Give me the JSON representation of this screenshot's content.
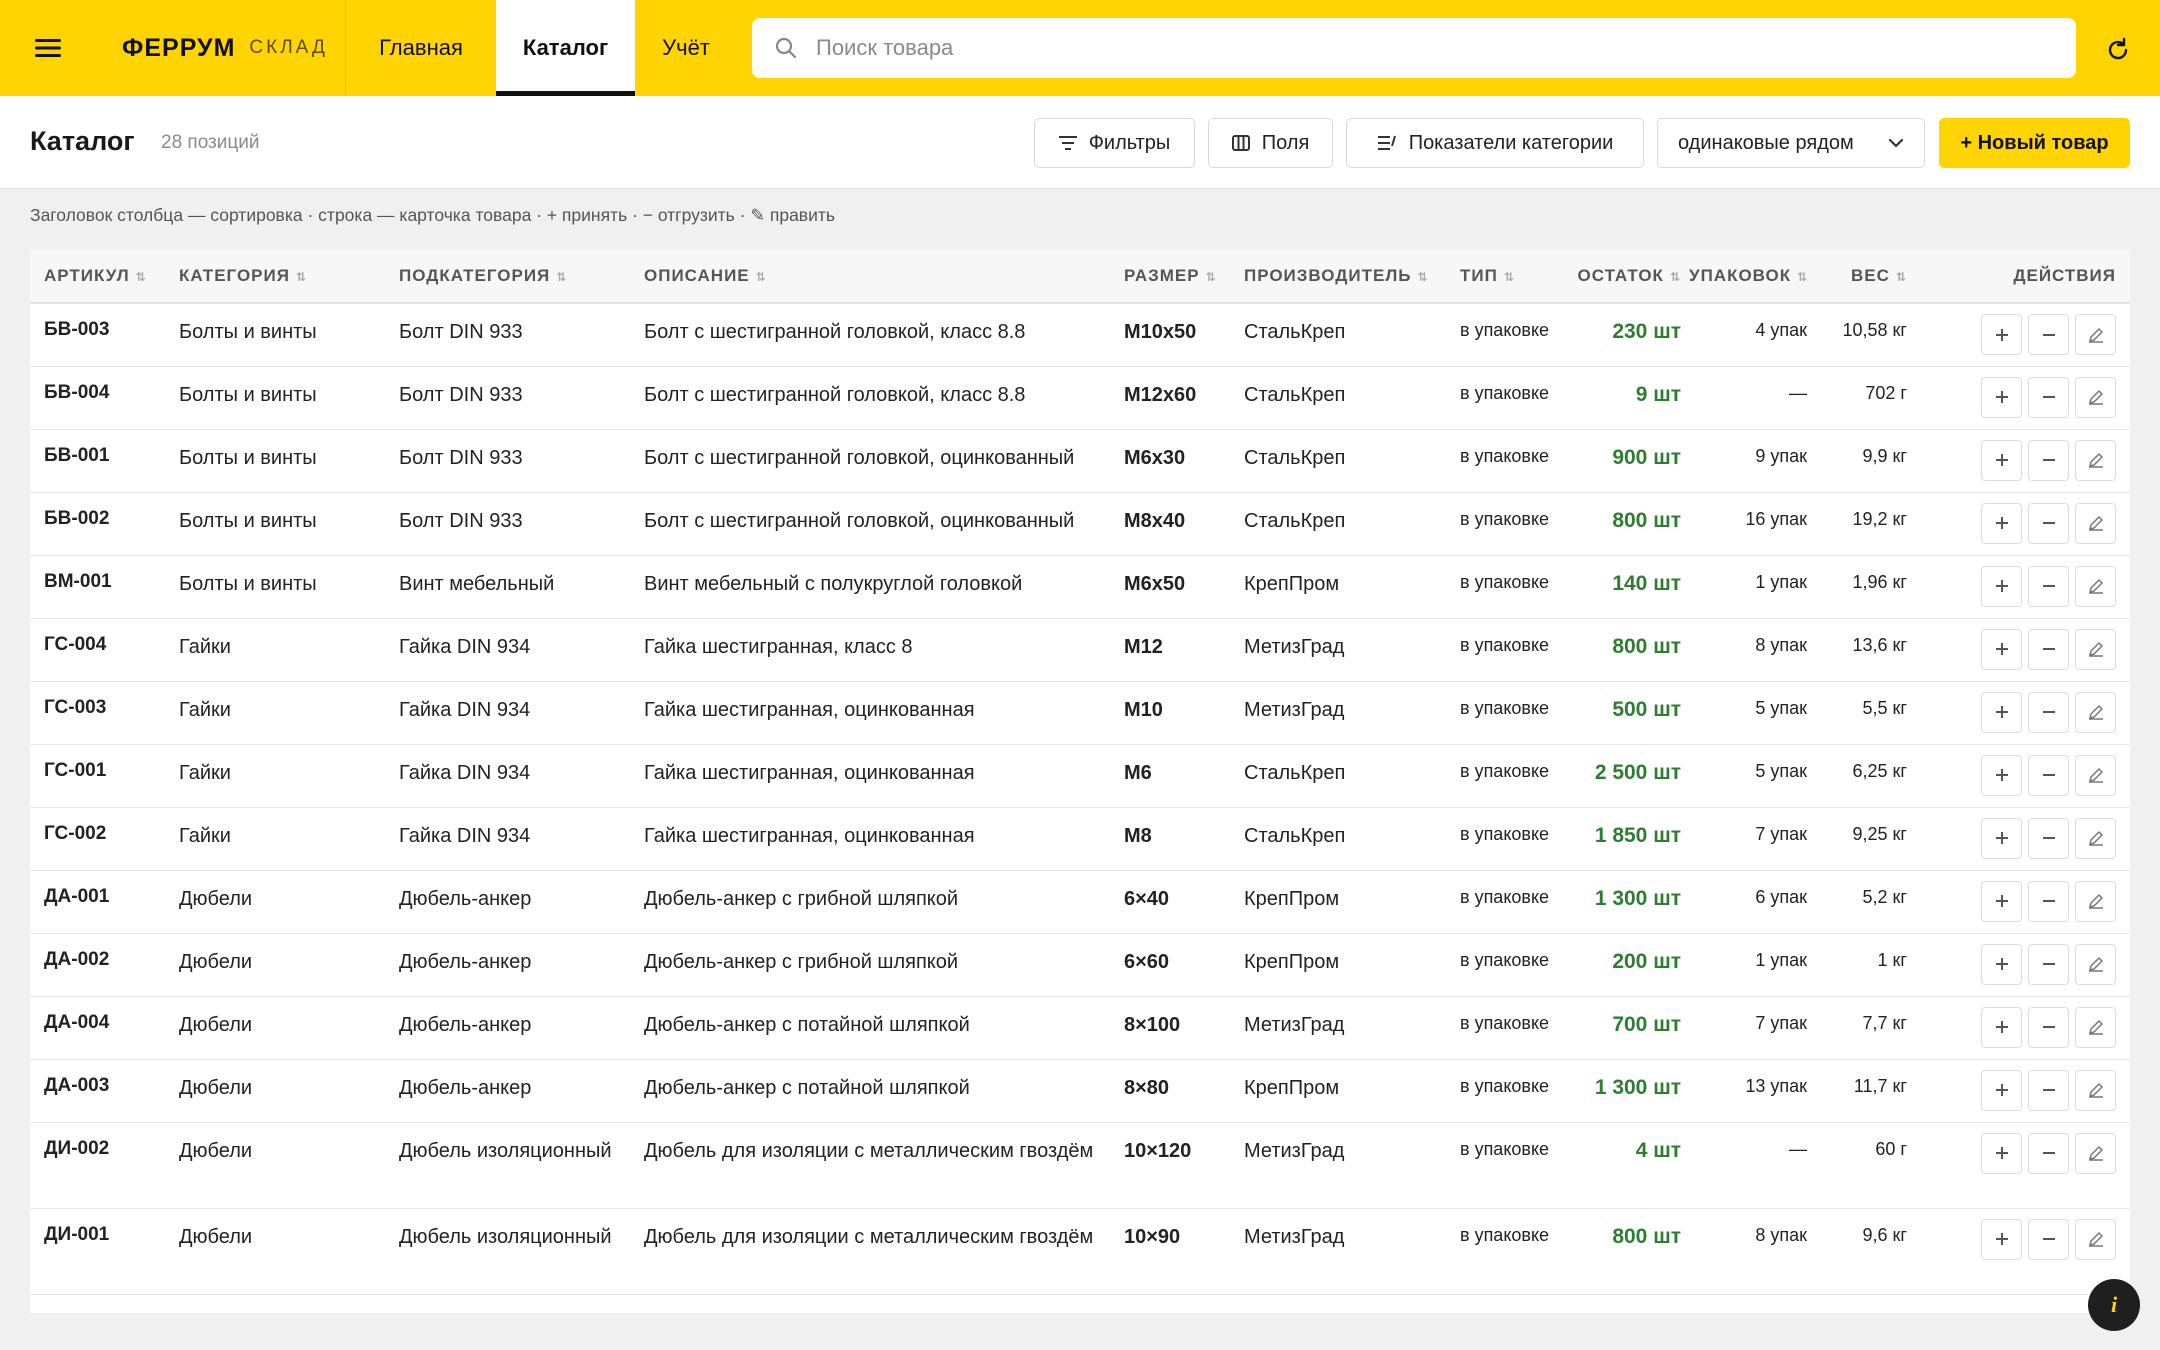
{
  "app": {
    "logo_main": "ФЕРРУМ",
    "logo_sub": "СКЛАД"
  },
  "nav": {
    "home": "Главная",
    "catalog": "Каталог",
    "accounting": "Учёт"
  },
  "search": {
    "placeholder": "Поиск товара"
  },
  "toolbar": {
    "title": "Каталог",
    "count": "28 позиций",
    "filters": "Фильтры",
    "fields": "Поля",
    "category_metrics": "Показатели категории",
    "grouping": "одинаковые рядом",
    "new_item": "+ Новый товар"
  },
  "hint": "Заголовок столбца — сортировка · строка — карточка товара · + принять · − отгрузить · ✎ править",
  "columns": {
    "sku": "АРТИКУЛ",
    "category": "КАТЕГОРИЯ",
    "subcategory": "ПОДКАТЕГОРИЯ",
    "description": "ОПИСАНИЕ",
    "size": "РАЗМЕР",
    "manufacturer": "ПРОИЗВОДИТЕЛЬ",
    "type": "ТИП",
    "stock": "ОСТАТОК",
    "packs": "УПАКОВОК",
    "weight": "ВЕС",
    "actions": "ДЕЙСТВИЯ"
  },
  "rows": [
    {
      "sku": "БВ-003",
      "category": "Болты и винты",
      "subcategory": "Болт DIN 933",
      "description": "Болт с шестигранной головкой, класс 8.8",
      "size": "M10x50",
      "manufacturer": "СтальКреп",
      "type": "в упаковке",
      "stock": "230 шт",
      "packs": "4 упак",
      "weight": "10,58 кг"
    },
    {
      "sku": "БВ-004",
      "category": "Болты и винты",
      "subcategory": "Болт DIN 933",
      "description": "Болт с шестигранной головкой, класс 8.8",
      "size": "M12x60",
      "manufacturer": "СтальКреп",
      "type": "в упаковке",
      "stock": "9 шт",
      "packs": "—",
      "weight": "702 г"
    },
    {
      "sku": "БВ-001",
      "category": "Болты и винты",
      "subcategory": "Болт DIN 933",
      "description": "Болт с шестигранной головкой, оцинкованный",
      "size": "M6x30",
      "manufacturer": "СтальКреп",
      "type": "в упаковке",
      "stock": "900 шт",
      "packs": "9 упак",
      "weight": "9,9 кг"
    },
    {
      "sku": "БВ-002",
      "category": "Болты и винты",
      "subcategory": "Болт DIN 933",
      "description": "Болт с шестигранной головкой, оцинкованный",
      "size": "M8x40",
      "manufacturer": "СтальКреп",
      "type": "в упаковке",
      "stock": "800 шт",
      "packs": "16 упак",
      "weight": "19,2 кг"
    },
    {
      "sku": "ВМ-001",
      "category": "Болты и винты",
      "subcategory": "Винт мебельный",
      "description": "Винт мебельный с полукруглой головкой",
      "size": "M6x50",
      "manufacturer": "КрепПром",
      "type": "в упаковке",
      "stock": "140 шт",
      "packs": "1 упак",
      "weight": "1,96 кг"
    },
    {
      "sku": "ГС-004",
      "category": "Гайки",
      "subcategory": "Гайка DIN 934",
      "description": "Гайка шестигранная, класс 8",
      "size": "M12",
      "manufacturer": "МетизГрад",
      "type": "в упаковке",
      "stock": "800 шт",
      "packs": "8 упак",
      "weight": "13,6 кг"
    },
    {
      "sku": "ГС-003",
      "category": "Гайки",
      "subcategory": "Гайка DIN 934",
      "description": "Гайка шестигранная, оцинкованная",
      "size": "M10",
      "manufacturer": "МетизГрад",
      "type": "в упаковке",
      "stock": "500 шт",
      "packs": "5 упак",
      "weight": "5,5 кг"
    },
    {
      "sku": "ГС-001",
      "category": "Гайки",
      "subcategory": "Гайка DIN 934",
      "description": "Гайка шестигранная, оцинкованная",
      "size": "M6",
      "manufacturer": "СтальКреп",
      "type": "в упаковке",
      "stock": "2 500 шт",
      "packs": "5 упак",
      "weight": "6,25 кг"
    },
    {
      "sku": "ГС-002",
      "category": "Гайки",
      "subcategory": "Гайка DIN 934",
      "description": "Гайка шестигранная, оцинкованная",
      "size": "M8",
      "manufacturer": "СтальКреп",
      "type": "в упаковке",
      "stock": "1 850 шт",
      "packs": "7 упак",
      "weight": "9,25 кг"
    },
    {
      "sku": "ДА-001",
      "category": "Дюбели",
      "subcategory": "Дюбель-анкер",
      "description": "Дюбель-анкер с грибной шляпкой",
      "size": "6×40",
      "manufacturer": "КрепПром",
      "type": "в упаковке",
      "stock": "1 300 шт",
      "packs": "6 упак",
      "weight": "5,2 кг"
    },
    {
      "sku": "ДА-002",
      "category": "Дюбели",
      "subcategory": "Дюбель-анкер",
      "description": "Дюбель-анкер с грибной шляпкой",
      "size": "6×60",
      "manufacturer": "КрепПром",
      "type": "в упаковке",
      "stock": "200 шт",
      "packs": "1 упак",
      "weight": "1 кг"
    },
    {
      "sku": "ДА-004",
      "category": "Дюбели",
      "subcategory": "Дюбель-анкер",
      "description": "Дюбель-анкер с потайной шляпкой",
      "size": "8×100",
      "manufacturer": "МетизГрад",
      "type": "в упаковке",
      "stock": "700 шт",
      "packs": "7 упак",
      "weight": "7,7 кг"
    },
    {
      "sku": "ДА-003",
      "category": "Дюбели",
      "subcategory": "Дюбель-анкер",
      "description": "Дюбель-анкер с потайной шляпкой",
      "size": "8×80",
      "manufacturer": "КрепПром",
      "type": "в упаковке",
      "stock": "1 300 шт",
      "packs": "13 упак",
      "weight": "11,7 кг"
    },
    {
      "sku": "ДИ-002",
      "category": "Дюбели",
      "subcategory": "Дюбель изоляционный",
      "description": "Дюбель для изоляции с металлическим гвоздём",
      "size": "10×120",
      "manufacturer": "МетизГрад",
      "type": "в упаковке",
      "stock": "4 шт",
      "packs": "—",
      "weight": "60 г"
    },
    {
      "sku": "ДИ-001",
      "category": "Дюбели",
      "subcategory": "Дюбель изоляционный",
      "description": "Дюбель для изоляции с металлическим гвоздём",
      "size": "10×90",
      "manufacturer": "МетизГрад",
      "type": "в упаковке",
      "stock": "800 шт",
      "packs": "8 упак",
      "weight": "9,6 кг"
    }
  ],
  "icons": {
    "menu": "hamburger-icon",
    "search": "search-icon",
    "refresh": "refresh-icon",
    "filter": "filter-icon",
    "fields": "columns-icon",
    "metrics": "metrics-icon",
    "chevron": "chevron-down-icon",
    "info": "info-icon"
  },
  "colors": {
    "brand": "#ffd400",
    "stock": "#2e7d32"
  }
}
